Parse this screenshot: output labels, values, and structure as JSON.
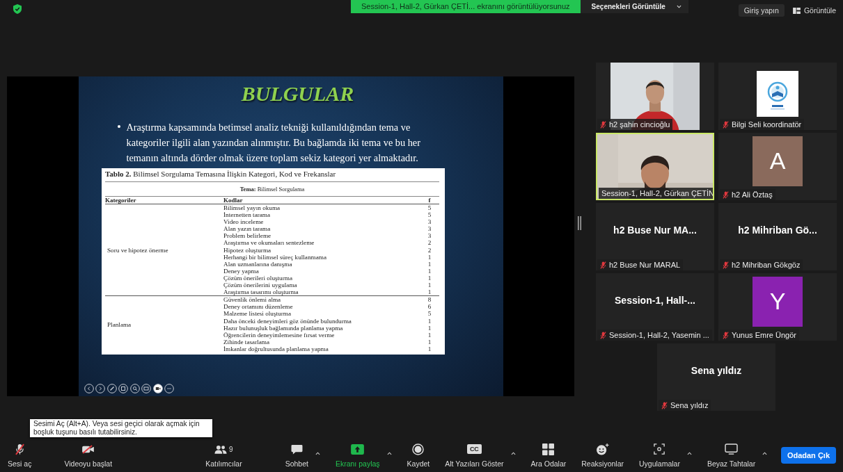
{
  "top_bar": {
    "sharing_banner": "Session-1, Hall-2, Gürkan ÇETİ... ekranını görüntülüyorsunuz",
    "options_button": "Seçenekleri Görüntüle",
    "sign_in_button": "Giriş yapın",
    "view_button": "Görüntüle"
  },
  "slide": {
    "title": "BULGULAR",
    "bullets": [
      "Araştırma kapsamında betimsel analiz tekniği kullanıldığından tema ve kategoriler ilgili alan yazından alınmıştır. Bu bağlamda iki tema ve bu her temanın altında dörder olmak üzere toplam sekiz kategori yer almaktadır."
    ],
    "table": {
      "caption": "**Tablo 2.** Bilimsel Sorgulama Temasına İlişkin Kategori, Kod ve Frekanslar",
      "theme": "**Tema:** Bilimsel Sorgulama",
      "columns": [
        "Kategoriler",
        "Kodlar",
        "f"
      ],
      "groups": [
        {
          "category": "Soru ve hipotez önerme",
          "codes": [
            {
              "code": "Bilimsel yayın okuma",
              "f": "5"
            },
            {
              "code": "İnternetten tarama",
              "f": "5"
            },
            {
              "code": "Video inceleme",
              "f": "3"
            },
            {
              "code": "Alan yazın tarama",
              "f": "3"
            },
            {
              "code": "Problem belirleme",
              "f": "3"
            },
            {
              "code": "Araştırma ve okumaları sentezleme",
              "f": "2"
            },
            {
              "code": "Hipotez oluşturma",
              "f": "2"
            },
            {
              "code": "Herhangi bir bilimsel süreç kullanmama",
              "f": "1"
            },
            {
              "code": "Alan uzmanlarına danışma",
              "f": "1"
            },
            {
              "code": "Deney yapma",
              "f": "1"
            },
            {
              "code": "Çözüm önerileri oluşturma",
              "f": "1"
            },
            {
              "code": "Çözüm önerilerini uygulama",
              "f": "1"
            },
            {
              "code": "Araştırma tasarımı oluşturma",
              "f": "1"
            }
          ]
        },
        {
          "category": "Planlama",
          "codes": [
            {
              "code": "Güvenlik önlemi alma",
              "f": "8"
            },
            {
              "code": "Deney ortamını düzenleme",
              "f": "6"
            },
            {
              "code": "Malzeme listesi oluşturma",
              "f": "5"
            },
            {
              "code": "Daha önceki deneyimleri göz önünde bulundurma",
              "f": "1"
            },
            {
              "code": "Hazır bulunuşluk bağlamında planlama yapma",
              "f": "1"
            },
            {
              "code": "Öğrencilerin deneyimlemesine fırsat verme",
              "f": "1"
            },
            {
              "code": "Zihinde tasarlama",
              "f": "1"
            },
            {
              "code": "İmkanlar doğrultusunda planlama yapma",
              "f": "1"
            }
          ]
        }
      ]
    }
  },
  "participants": [
    {
      "kind": "video",
      "name": "h2 şahin cincioğlu",
      "muted": true,
      "active_speaker": false
    },
    {
      "kind": "picture",
      "name": "Bilgi Seli koordinatör",
      "muted": true,
      "active_speaker": false
    },
    {
      "kind": "video",
      "name": "Session-1, Hall-2, Gürkan ÇETİN",
      "muted": false,
      "active_speaker": true
    },
    {
      "kind": "avatar",
      "initial": "A",
      "color": "#8a6a5c",
      "name": "h2 Ali Öztaş",
      "muted": true,
      "active_speaker": false
    },
    {
      "kind": "name",
      "display": "h2 Buse Nur MA...",
      "name": "h2 Buse Nur MARAL",
      "muted": true,
      "active_speaker": false
    },
    {
      "kind": "name",
      "display": "h2  Mihriban Gö...",
      "name": "h2 Mihriban Gökgöz",
      "muted": true,
      "active_speaker": false
    },
    {
      "kind": "name",
      "display": "Session-1,  Hall-...",
      "name": "Session-1, Hall-2, Yasemin ...",
      "muted": true,
      "active_speaker": false
    },
    {
      "kind": "avatar",
      "initial": "Y",
      "color": "#8a22b0",
      "name": "Yunus Emre Üngör",
      "muted": true,
      "active_speaker": false
    },
    {
      "kind": "name",
      "display": "Sena yıldız",
      "name": "Sena yıldız",
      "muted": true,
      "active_speaker": false
    }
  ],
  "tooltip": "Sesimi Aç (Alt+A). Veya sesi geçici olarak açmak için boşluk tuşunu basılı tutabilirsiniz.",
  "toolbar": [
    {
      "kind": "mic",
      "label": "Sesi aç",
      "menu": false,
      "active": false
    },
    {
      "kind": "camera",
      "label": "Videoyu başlat",
      "menu": false,
      "active": false
    },
    {
      "kind": "people",
      "label": "Katılımcılar",
      "count": "9",
      "menu": false,
      "active": false
    },
    {
      "kind": "chat",
      "label": "Sohbet",
      "menu": true,
      "active": false
    },
    {
      "kind": "share",
      "label": "Ekranı paylaş",
      "menu": true,
      "active": true
    },
    {
      "kind": "record",
      "label": "Kaydet",
      "menu": false,
      "active": false
    },
    {
      "kind": "captions",
      "label": "Alt Yazıları Göster",
      "badge": "CC",
      "menu": true,
      "active": false
    },
    {
      "kind": "rooms",
      "label": "Ara Odalar",
      "menu": false,
      "active": false
    },
    {
      "kind": "reactions",
      "label": "Reaksiyonlar",
      "menu": false,
      "active": false
    },
    {
      "kind": "apps",
      "label": "Uygulamalar",
      "menu": true,
      "active": false
    },
    {
      "kind": "whiteboard",
      "label": "Beyaz Tahtalar",
      "menu": true,
      "active": false
    }
  ],
  "leave_button": "Odadan Çık"
}
